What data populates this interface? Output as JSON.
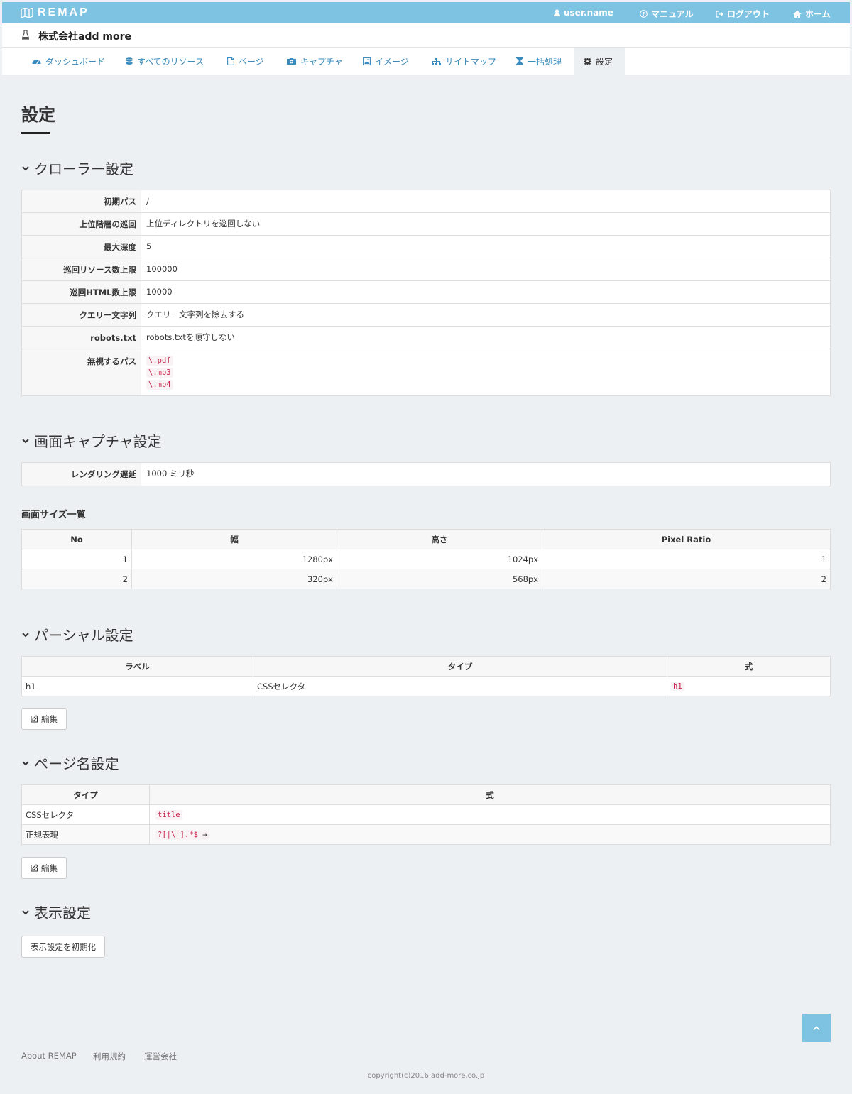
{
  "app": {
    "logo": "REMAP"
  },
  "topnav": {
    "user": "user.name",
    "manual": "マニュアル",
    "logout": "ログアウト",
    "home": "ホーム"
  },
  "org": {
    "name": "株式会社add more"
  },
  "tabs": [
    {
      "label": "ダッシュボード",
      "icon": "dashboard-icon"
    },
    {
      "label": "すべてのリソース",
      "icon": "database-icon"
    },
    {
      "label": "ページ",
      "icon": "file-icon"
    },
    {
      "label": "キャプチャ",
      "icon": "camera-icon"
    },
    {
      "label": "イメージ",
      "icon": "image-icon"
    },
    {
      "label": "サイトマップ",
      "icon": "sitemap-icon"
    },
    {
      "label": "一括処理",
      "icon": "hourglass-icon"
    },
    {
      "label": "設定",
      "icon": "gear-icon",
      "active": true
    }
  ],
  "page": {
    "title": "設定"
  },
  "crawler": {
    "heading": "クローラー設定",
    "rows": [
      {
        "key": "初期パス",
        "value": "/"
      },
      {
        "key": "上位階層の巡回",
        "value": "上位ディレクトリを巡回しない"
      },
      {
        "key": "最大深度",
        "value": "5"
      },
      {
        "key": "巡回リソース数上限",
        "value": "100000"
      },
      {
        "key": "巡回HTML数上限",
        "value": "10000"
      },
      {
        "key": "クエリー文字列",
        "value": "クエリー文字列を除去する"
      },
      {
        "key": "robots.txt",
        "value": "robots.txtを順守しない"
      }
    ],
    "ignore_key": "無視するパス",
    "ignore_paths": [
      "\\.pdf",
      "\\.mp3",
      "\\.mp4"
    ]
  },
  "capture": {
    "heading": "画面キャプチャ設定",
    "delay_key": "レンダリング遅延",
    "delay_value": "1000 ミリ秒",
    "sizes_heading": "画面サイズ一覧",
    "columns": [
      "No",
      "幅",
      "高さ",
      "Pixel Ratio"
    ],
    "rows": [
      [
        "1",
        "1280px",
        "1024px",
        "1"
      ],
      [
        "2",
        "320px",
        "568px",
        "2"
      ]
    ]
  },
  "partial": {
    "heading": "パーシャル設定",
    "columns": [
      "ラベル",
      "タイプ",
      "式"
    ],
    "rows": [
      {
        "label": "h1",
        "type": "CSSセレクタ",
        "expr": "h1"
      }
    ],
    "edit": "編集"
  },
  "pagename": {
    "heading": "ページ名設定",
    "columns": [
      "タイプ",
      "式"
    ],
    "rows": [
      {
        "type": "CSSセレクタ",
        "expr": "title",
        "suffix": ""
      },
      {
        "type": "正規表現",
        "expr": "?[|\\|].*$",
        "suffix": "→"
      }
    ],
    "edit": "編集"
  },
  "display": {
    "heading": "表示設定",
    "reset": "表示設定を初期化"
  },
  "footer": {
    "links": [
      "About REMAP",
      "利用規約",
      "運営会社"
    ],
    "copyright": "copyright(c)2016 add-more.co.jp"
  },
  "colors": {
    "brand": "#7ec3e2",
    "link": "#3a8bbd",
    "code": "#c7254e"
  }
}
